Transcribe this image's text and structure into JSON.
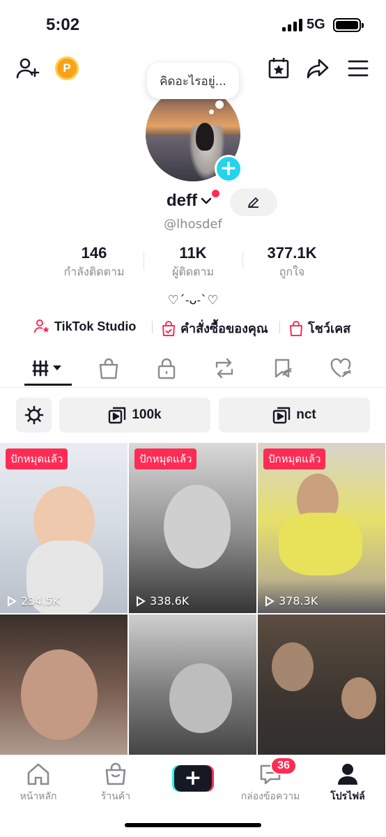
{
  "status_bar": {
    "time": "5:02",
    "network": "5G"
  },
  "note_bubble": "คิดอะไรอยู่...",
  "profile": {
    "username": "deff",
    "handle": "@lhosdef",
    "bio": "♡ˊ˗ᴗ˗ˋ♡"
  },
  "stats": [
    {
      "value": "146",
      "label": "กำลังติดตาม"
    },
    {
      "value": "11K",
      "label": "ผู้ติดตาม"
    },
    {
      "value": "377.1K",
      "label": "ถูกใจ"
    }
  ],
  "links": {
    "studio": "TikTok Studio",
    "orders": "คำสั่งซื้อของคุณ",
    "showcase": "โชว์เคส"
  },
  "collections": [
    "100k",
    "nct"
  ],
  "videos": [
    {
      "pinned_label": "ปักหมุดแล้ว",
      "views": "234.5K",
      "pinned": true
    },
    {
      "pinned_label": "ปักหมุดแล้ว",
      "views": "338.6K",
      "pinned": true
    },
    {
      "pinned_label": "ปักหมุดแล้ว",
      "views": "378.3K",
      "pinned": true
    },
    {
      "pinned_label": "",
      "views": "",
      "pinned": false
    },
    {
      "pinned_label": "",
      "views": "",
      "pinned": false
    },
    {
      "pinned_label": "",
      "views": "",
      "pinned": false
    }
  ],
  "bottom_nav": {
    "home": "หน้าหลัก",
    "shop": "ร้านค้า",
    "inbox": "กล่องข้อความ",
    "profile": "โปรไฟล์",
    "inbox_badge": "36"
  },
  "colors": {
    "accent": "#fe2c55",
    "cyan": "#25f4ee",
    "add": "#20d5ec"
  }
}
